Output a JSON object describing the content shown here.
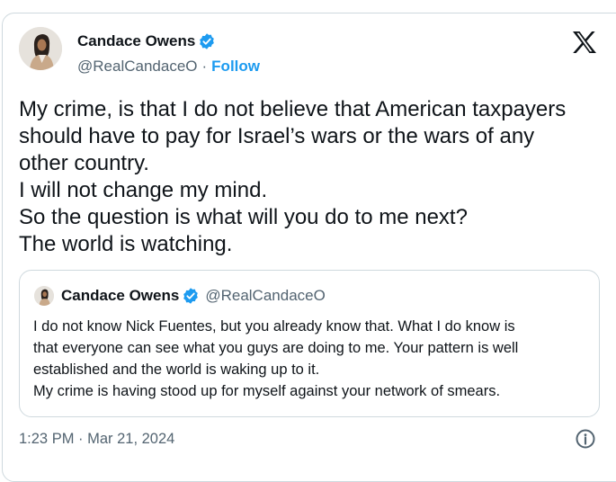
{
  "tweet": {
    "author": {
      "name": "Candace Owens",
      "handle": "@RealCandaceO",
      "separator": "·",
      "follow_label": "Follow"
    },
    "body_lines": [
      "My crime, is that I do not believe that American taxpayers",
      "should have to pay for Israel’s wars or the wars of any",
      "other country.",
      "I will not change my mind.",
      "So the question is what will you do to me next?",
      "The world is watching."
    ],
    "timestamp": "1:23 PM · Mar 21, 2024"
  },
  "quoted_tweet": {
    "author": {
      "name": "Candace Owens",
      "handle": "@RealCandaceO"
    },
    "body_lines": [
      "I do not know Nick Fuentes, but you already know that. What I do know is",
      "that everyone can see what you guys are doing to me. Your pattern is well",
      "established and the world is waking up to it.",
      "My crime is having stood up for myself against your network of smears."
    ]
  },
  "icons": {
    "logo": "x-logo-icon",
    "verified": "verified-badge-icon",
    "info": "info-icon"
  },
  "colors": {
    "accent": "#1d9bf0",
    "text": "#0f1419",
    "secondary_text": "#536471",
    "border": "#cfd9de"
  }
}
